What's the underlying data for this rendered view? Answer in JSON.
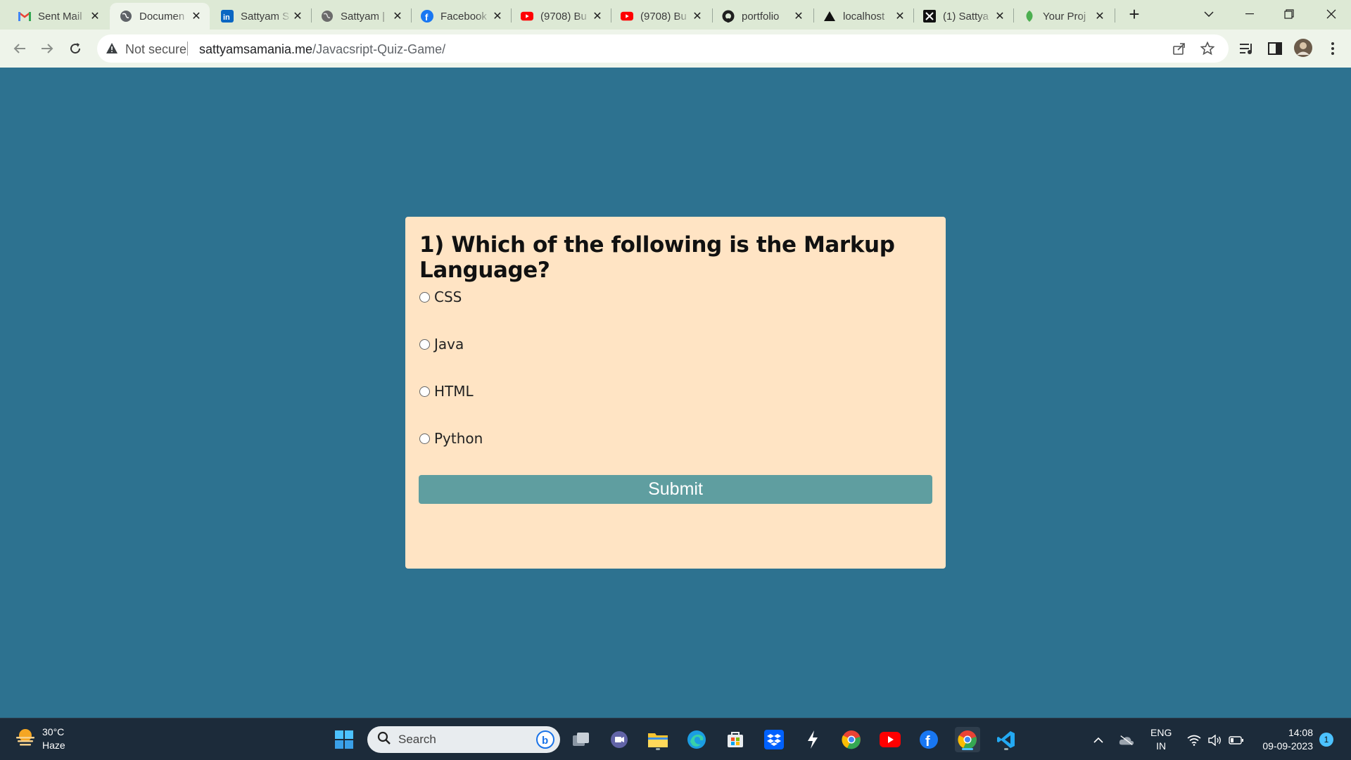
{
  "browser": {
    "tabs": [
      {
        "label": "Sent Mail",
        "icon": "gmail-icon"
      },
      {
        "label": "Documen",
        "icon": "globe-icon",
        "active": true
      },
      {
        "label": "Sattyam S",
        "icon": "linkedin-icon"
      },
      {
        "label": "Sattyam |",
        "icon": "globe-icon"
      },
      {
        "label": "Facebook",
        "icon": "facebook-icon"
      },
      {
        "label": "(9708) Bu",
        "icon": "youtube-icon"
      },
      {
        "label": "(9708) Bu",
        "icon": "youtube-icon"
      },
      {
        "label": "portfolio",
        "icon": "github-icon"
      },
      {
        "label": "localhost",
        "icon": "vercel-icon"
      },
      {
        "label": "(1) Sattya",
        "icon": "x-icon"
      },
      {
        "label": "Your Proj",
        "icon": "leaf-icon"
      }
    ],
    "address": {
      "security": "Not secure",
      "host": "sattyamsamania.me",
      "path": "/Javacsript-Quiz-Game/"
    }
  },
  "quiz": {
    "question": "1) Which of the following is the Markup Language?",
    "options": [
      "CSS",
      "Java",
      "HTML",
      "Python"
    ],
    "submit_label": "Submit"
  },
  "taskbar": {
    "weather": {
      "temp": "30°C",
      "condition": "Haze"
    },
    "search_placeholder": "Search",
    "lang": {
      "line1": "ENG",
      "line2": "IN"
    },
    "clock": {
      "time": "14:08",
      "date": "09-09-2023"
    },
    "notifications": "1"
  },
  "colors": {
    "page_bg": "#2d7290",
    "card_bg": "#ffe4c4",
    "submit_bg": "#5f9ea0"
  }
}
